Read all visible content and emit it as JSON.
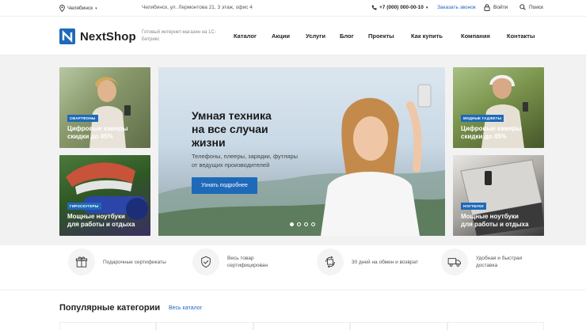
{
  "topbar": {
    "city": "Челябинск",
    "address": "Челябинск, ул. Лермонтова 21, 3 этаж, офис 4",
    "phone": "+7 (000) 000-00-10",
    "call_link": "Заказать звонок",
    "login": "Войти",
    "search": "Поиск"
  },
  "header": {
    "logo": "NextShop",
    "tagline": "Готовый интернет-магазин на 1С-Битрикс",
    "nav": [
      "Каталог",
      "Акции",
      "Услуги",
      "Блог",
      "Проекты",
      "Как купить",
      "Компания",
      "Контакты"
    ]
  },
  "tiles": [
    {
      "badge": "Смартфоны",
      "caption_line1": "Цифровые камеры",
      "caption_line2": "скидки до 45%"
    },
    {
      "badge": "Гироскутеры",
      "caption_line1": "Мощные ноутбуки",
      "caption_line2": "для работы и отдыха"
    },
    {
      "badge": "Модные гаджеты",
      "caption_line1": "Цифровые камеры",
      "caption_line2": "скидки до 45%"
    },
    {
      "badge": "Ноутбуки",
      "caption_line1": "Мощные ноутбуки",
      "caption_line2": "для работы и отдыха"
    }
  ],
  "hero": {
    "title_line1": "Умная техника",
    "title_line2": "на все случаи",
    "title_line3": "жизни",
    "subtitle_line1": "Телефоны, плееры, зарядки, футляры",
    "subtitle_line2": "от ведущих производителей",
    "button": "Узнать подробнее",
    "slides": 4,
    "active_slide": 1
  },
  "features": [
    {
      "icon": "gift-icon",
      "line1": "Подарочные сертификаты",
      "line2": ""
    },
    {
      "icon": "shield-check-icon",
      "line1": "Весь товар",
      "line2": "сертифицирован"
    },
    {
      "icon": "return-icon",
      "line1": "30 дней на обмен и возврат",
      "line2": ""
    },
    {
      "icon": "truck-icon",
      "line1": "Удобная и быстрая",
      "line2": "доставка"
    }
  ],
  "categories": {
    "title": "Популярные категории",
    "link": "Весь каталог"
  },
  "colors": {
    "accent": "#1e6ab8",
    "link": "#1d64c0"
  }
}
